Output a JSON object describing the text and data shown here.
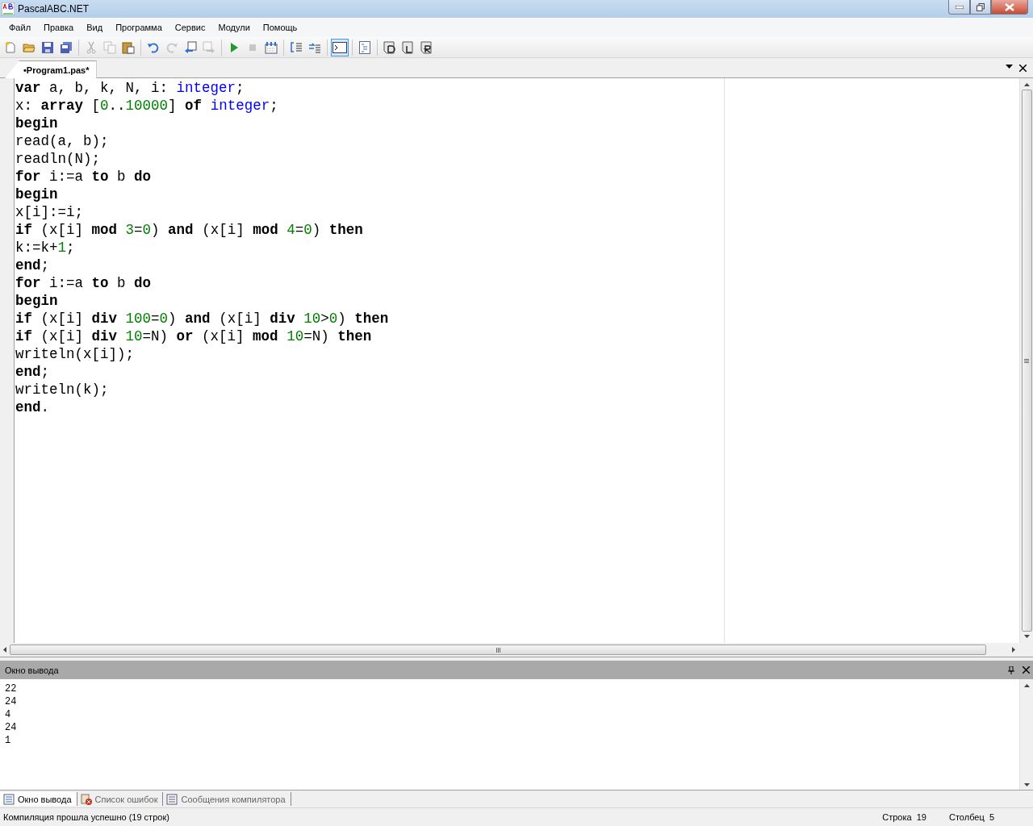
{
  "window": {
    "title": "PascalABC.NET"
  },
  "menu": [
    "Файл",
    "Правка",
    "Вид",
    "Программа",
    "Сервис",
    "Модули",
    "Помощь"
  ],
  "toolbar": [
    {
      "kind": "new",
      "disabled": false,
      "selected": false
    },
    {
      "kind": "open",
      "disabled": false,
      "selected": false
    },
    {
      "kind": "save",
      "disabled": false,
      "selected": false
    },
    {
      "kind": "save-all",
      "disabled": false,
      "selected": false
    },
    {
      "kind": "separator"
    },
    {
      "kind": "cut",
      "disabled": true,
      "selected": false
    },
    {
      "kind": "copy",
      "disabled": true,
      "selected": false
    },
    {
      "kind": "paste",
      "disabled": false,
      "selected": false
    },
    {
      "kind": "separator"
    },
    {
      "kind": "undo",
      "disabled": false,
      "selected": false
    },
    {
      "kind": "redo",
      "disabled": true,
      "selected": false
    },
    {
      "kind": "nav-back",
      "disabled": false,
      "selected": false
    },
    {
      "kind": "nav-forward",
      "disabled": true,
      "selected": false
    },
    {
      "kind": "separator"
    },
    {
      "kind": "run",
      "disabled": false,
      "selected": false
    },
    {
      "kind": "stop",
      "disabled": true,
      "selected": false
    },
    {
      "kind": "compile",
      "disabled": false,
      "selected": false
    },
    {
      "kind": "separator"
    },
    {
      "kind": "step-into",
      "disabled": false,
      "selected": false
    },
    {
      "kind": "step-over",
      "disabled": false,
      "selected": false
    },
    {
      "kind": "separator"
    },
    {
      "kind": "console",
      "disabled": false,
      "selected": true
    },
    {
      "kind": "separator"
    },
    {
      "kind": "format",
      "disabled": false,
      "selected": false
    },
    {
      "kind": "separator"
    },
    {
      "kind": "d",
      "disabled": false,
      "selected": false
    },
    {
      "kind": "l",
      "disabled": false,
      "selected": false
    },
    {
      "kind": "r",
      "disabled": false,
      "selected": false
    }
  ],
  "editor_tabs": [
    {
      "label": "•Program1.pas*",
      "selected": true
    }
  ],
  "code": [
    [
      {
        "t": "var",
        "kind": "kw"
      },
      {
        "t": " a, b, k, N, i: ",
        "kind": "id"
      },
      {
        "t": "integer",
        "kind": "type"
      },
      {
        "t": ";",
        "kind": "id"
      }
    ],
    [
      {
        "t": "x: ",
        "kind": "id"
      },
      {
        "t": "array",
        "kind": "kw"
      },
      {
        "t": " [",
        "kind": "id"
      },
      {
        "t": "0",
        "kind": "num"
      },
      {
        "t": "..",
        "kind": "id"
      },
      {
        "t": "10000",
        "kind": "num"
      },
      {
        "t": "] ",
        "kind": "id"
      },
      {
        "t": "of",
        "kind": "kw"
      },
      {
        "t": " integer",
        "kind": "type"
      },
      {
        "t": ";",
        "kind": "id"
      }
    ],
    [
      {
        "t": "begin",
        "kind": "kw"
      }
    ],
    [
      {
        "t": "read(a, b);",
        "kind": "id"
      }
    ],
    [
      {
        "t": "readln(N);",
        "kind": "id"
      }
    ],
    [
      {
        "t": "for",
        "kind": "kw"
      },
      {
        "t": " i:=a ",
        "kind": "id"
      },
      {
        "t": "to",
        "kind": "kw"
      },
      {
        "t": " b ",
        "kind": "id"
      },
      {
        "t": "do",
        "kind": "kw"
      }
    ],
    [
      {
        "t": "begin",
        "kind": "kw"
      }
    ],
    [
      {
        "t": "x[i]:=i;",
        "kind": "id"
      }
    ],
    [
      {
        "t": "if",
        "kind": "kw"
      },
      {
        "t": " (x[i] ",
        "kind": "id"
      },
      {
        "t": "mod",
        "kind": "kw"
      },
      {
        "t": " 3",
        "kind": "num"
      },
      {
        "t": "=",
        "kind": "id"
      },
      {
        "t": "0",
        "kind": "num"
      },
      {
        "t": ") ",
        "kind": "id"
      },
      {
        "t": "and",
        "kind": "kw"
      },
      {
        "t": " (x[i] ",
        "kind": "id"
      },
      {
        "t": "mod",
        "kind": "kw"
      },
      {
        "t": " 4",
        "kind": "num"
      },
      {
        "t": "=",
        "kind": "id"
      },
      {
        "t": "0",
        "kind": "num"
      },
      {
        "t": ") ",
        "kind": "id"
      },
      {
        "t": "then",
        "kind": "kw"
      }
    ],
    [
      {
        "t": "k:=k+",
        "kind": "id"
      },
      {
        "t": "1",
        "kind": "num"
      },
      {
        "t": ";",
        "kind": "id"
      }
    ],
    [
      {
        "t": "end",
        "kind": "kw"
      },
      {
        "t": ";",
        "kind": "id"
      }
    ],
    [
      {
        "t": "for",
        "kind": "kw"
      },
      {
        "t": " i:=a ",
        "kind": "id"
      },
      {
        "t": "to",
        "kind": "kw"
      },
      {
        "t": " b ",
        "kind": "id"
      },
      {
        "t": "do",
        "kind": "kw"
      }
    ],
    [
      {
        "t": "begin",
        "kind": "kw"
      }
    ],
    [
      {
        "t": "if",
        "kind": "kw"
      },
      {
        "t": " (x[i] ",
        "kind": "id"
      },
      {
        "t": "div",
        "kind": "kw"
      },
      {
        "t": " 100",
        "kind": "num"
      },
      {
        "t": "=",
        "kind": "id"
      },
      {
        "t": "0",
        "kind": "num"
      },
      {
        "t": ") ",
        "kind": "id"
      },
      {
        "t": "and",
        "kind": "kw"
      },
      {
        "t": " (x[i] ",
        "kind": "id"
      },
      {
        "t": "div",
        "kind": "kw"
      },
      {
        "t": " 10",
        "kind": "num"
      },
      {
        "t": ">",
        "kind": "id"
      },
      {
        "t": "0",
        "kind": "num"
      },
      {
        "t": ") ",
        "kind": "id"
      },
      {
        "t": "then",
        "kind": "kw"
      }
    ],
    [
      {
        "t": "if",
        "kind": "kw"
      },
      {
        "t": " (x[i] ",
        "kind": "id"
      },
      {
        "t": "div",
        "kind": "kw"
      },
      {
        "t": " 10",
        "kind": "num"
      },
      {
        "t": "=N) ",
        "kind": "id"
      },
      {
        "t": "or",
        "kind": "kw"
      },
      {
        "t": " (x[i] ",
        "kind": "id"
      },
      {
        "t": "mod",
        "kind": "kw"
      },
      {
        "t": " 10",
        "kind": "num"
      },
      {
        "t": "=N) ",
        "kind": "id"
      },
      {
        "t": "then",
        "kind": "kw"
      }
    ],
    [
      {
        "t": "writeln(x[i]);",
        "kind": "id"
      }
    ],
    [
      {
        "t": "end",
        "kind": "kw"
      },
      {
        "t": ";",
        "kind": "id"
      }
    ],
    [
      {
        "t": "writeln(k);",
        "kind": "id"
      }
    ],
    [
      {
        "t": "end",
        "kind": "kw"
      },
      {
        "t": ".",
        "kind": "id"
      }
    ]
  ],
  "output_panel": {
    "title": "Окно вывода",
    "lines": [
      "22",
      "24",
      "4",
      "24",
      "1"
    ]
  },
  "bottom_tabs": [
    {
      "label": "Окно вывода",
      "kind": "output",
      "selected": true
    },
    {
      "label": "Список ошибок",
      "kind": "errors",
      "selected": false
    },
    {
      "label": "Сообщения компилятора",
      "kind": "messages",
      "selected": false
    }
  ],
  "status_bar": {
    "message": "Компиляция прошла успешно (19 строк)",
    "line_label": "Строка",
    "line": "19",
    "column_label": "Столбец",
    "column": "5"
  }
}
